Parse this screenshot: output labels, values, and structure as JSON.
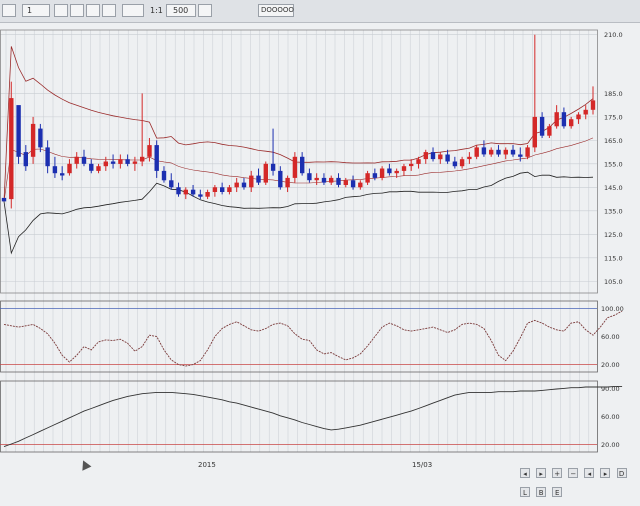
{
  "toolbar": {
    "period_value": "1",
    "mode_label": "1:1",
    "count_value": "500",
    "symbol_label": "DOOOOO"
  },
  "chart_data": {
    "type": "candlestick",
    "price_axis": {
      "ticks": [
        "210.0",
        "185.0",
        "175.0",
        "165.0",
        "155.0",
        "145.0",
        "135.0",
        "125.0",
        "115.0",
        "105.0"
      ],
      "ylim": [
        100,
        212
      ]
    },
    "osc1_axis": {
      "ticks": [
        "100.00",
        "60.00",
        "20.00"
      ]
    },
    "osc2_axis": {
      "ticks": [
        "90.00",
        "60.00",
        "20.00"
      ]
    },
    "x_labels": [
      "2015",
      "15/03"
    ],
    "candles": [
      [
        140.5,
        140.0,
        139.5,
        139.0
      ],
      [
        140.0,
        190.0,
        136.0,
        183.0
      ],
      [
        180.0,
        178.0,
        155.0,
        158.0
      ],
      [
        160.0,
        163.0,
        152.0,
        154.0
      ],
      [
        158.0,
        175.0,
        155.0,
        172.0
      ],
      [
        170.0,
        172.0,
        160.0,
        162.0
      ],
      [
        162.0,
        165.0,
        151.0,
        154.0
      ],
      [
        154.0,
        158.0,
        149.0,
        151.0
      ],
      [
        151.0,
        154.0,
        148.0,
        150.0
      ],
      [
        151.0,
        157.0,
        150.0,
        155.0
      ],
      [
        155.0,
        160.0,
        153.0,
        158.0
      ],
      [
        158.0,
        161.0,
        154.0,
        155.0
      ],
      [
        155.0,
        157.0,
        151.0,
        152.0
      ],
      [
        152.0,
        155.0,
        151.0,
        154.0
      ],
      [
        154.0,
        158.0,
        152.0,
        156.0
      ],
      [
        156.0,
        159.0,
        153.0,
        155.0
      ],
      [
        155.0,
        159.0,
        153.0,
        157.0
      ],
      [
        157.0,
        159.0,
        154.0,
        155.0
      ],
      [
        155.0,
        158.0,
        152.0,
        156.0
      ],
      [
        156.0,
        185.0,
        154.0,
        158.0
      ],
      [
        158.0,
        166.0,
        156.0,
        163.0
      ],
      [
        163.0,
        165.0,
        149.0,
        152.0
      ],
      [
        152.0,
        154.0,
        147.0,
        148.0
      ],
      [
        148.0,
        151.0,
        144.0,
        145.0
      ],
      [
        145.0,
        147.0,
        141.0,
        142.0
      ],
      [
        142.0,
        145.0,
        140.0,
        144.0
      ],
      [
        144.0,
        146.0,
        141.0,
        142.0
      ],
      [
        142.0,
        144.0,
        140.0,
        141.0
      ],
      [
        141.0,
        144.0,
        140.0,
        143.0
      ],
      [
        143.0,
        146.0,
        141.0,
        145.0
      ],
      [
        145.0,
        147.0,
        142.0,
        143.0
      ],
      [
        143.0,
        146.0,
        142.0,
        145.0
      ],
      [
        145.0,
        149.0,
        143.0,
        147.0
      ],
      [
        147.0,
        149.0,
        144.0,
        145.0
      ],
      [
        145.0,
        152.0,
        143.0,
        150.0
      ],
      [
        150.0,
        153.0,
        146.0,
        147.0
      ],
      [
        147.0,
        156.0,
        146.0,
        155.0
      ],
      [
        155.0,
        170.0,
        150.0,
        152.0
      ],
      [
        152.0,
        154.0,
        144.0,
        145.0
      ],
      [
        145.0,
        150.0,
        143.0,
        149.0
      ],
      [
        149.0,
        160.0,
        147.0,
        158.0
      ],
      [
        158.0,
        160.0,
        150.0,
        151.0
      ],
      [
        151.0,
        153.0,
        147.0,
        148.0
      ],
      [
        148.0,
        151.0,
        146.0,
        149.0
      ],
      [
        149.0,
        151.0,
        146.0,
        147.0
      ],
      [
        147.0,
        150.0,
        146.0,
        149.0
      ],
      [
        149.0,
        151.0,
        145.0,
        146.0
      ],
      [
        146.0,
        149.0,
        145.0,
        148.0
      ],
      [
        148.0,
        150.0,
        144.0,
        145.0
      ],
      [
        145.0,
        148.0,
        144.0,
        147.0
      ],
      [
        147.0,
        152.0,
        146.0,
        151.0
      ],
      [
        151.0,
        153.0,
        148.0,
        149.0
      ],
      [
        149.0,
        154.0,
        148.0,
        153.0
      ],
      [
        153.0,
        155.0,
        150.0,
        151.0
      ],
      [
        151.0,
        153.0,
        149.0,
        152.0
      ],
      [
        152.0,
        155.0,
        150.0,
        154.0
      ],
      [
        154.0,
        157.0,
        152.0,
        155.0
      ],
      [
        155.0,
        158.0,
        153.0,
        157.0
      ],
      [
        157.0,
        161.0,
        155.0,
        160.0
      ],
      [
        160.0,
        162.0,
        156.0,
        157.0
      ],
      [
        157.0,
        160.0,
        155.0,
        159.0
      ],
      [
        159.0,
        161.0,
        155.0,
        156.0
      ],
      [
        156.0,
        158.0,
        153.0,
        154.0
      ],
      [
        154.0,
        158.0,
        153.0,
        157.0
      ],
      [
        157.0,
        160.0,
        155.0,
        158.0
      ],
      [
        158.0,
        163.0,
        157.0,
        162.0
      ],
      [
        162.0,
        165.0,
        158.0,
        159.0
      ],
      [
        159.0,
        162.0,
        158.0,
        161.0
      ],
      [
        161.0,
        163.0,
        158.0,
        159.0
      ],
      [
        159.0,
        162.0,
        157.0,
        161.0
      ],
      [
        161.0,
        163.0,
        158.0,
        159.0
      ],
      [
        159.0,
        162.0,
        156.0,
        158.0
      ],
      [
        158.0,
        163.0,
        157.0,
        162.0
      ],
      [
        162.0,
        210.0,
        160.0,
        175.0
      ],
      [
        175.0,
        177.0,
        166.0,
        167.0
      ],
      [
        167.0,
        172.0,
        166.0,
        171.0
      ],
      [
        171.0,
        180.0,
        170.0,
        177.0
      ],
      [
        177.0,
        179.0,
        170.0,
        171.0
      ],
      [
        171.0,
        175.0,
        170.0,
        174.0
      ],
      [
        174.0,
        177.0,
        172.0,
        176.0
      ],
      [
        176.0,
        180.0,
        174.0,
        178.0
      ],
      [
        178.0,
        188.0,
        176.0,
        182.0
      ]
    ],
    "osc1": [
      68,
      66,
      64,
      66,
      68,
      62,
      54,
      40,
      22,
      12,
      22,
      35,
      30,
      42,
      45,
      44,
      46,
      40,
      28,
      35,
      52,
      50,
      30,
      15,
      8,
      6,
      8,
      14,
      30,
      50,
      62,
      68,
      72,
      66,
      60,
      58,
      62,
      68,
      70,
      66,
      54,
      46,
      44,
      30,
      24,
      26,
      20,
      15,
      18,
      24,
      36,
      50,
      64,
      70,
      66,
      60,
      58,
      60,
      62,
      64,
      60,
      56,
      60,
      68,
      70,
      68,
      62,
      44,
      22,
      14,
      28,
      48,
      70,
      74,
      70,
      64,
      60,
      58,
      70,
      72,
      60,
      52,
      64,
      78,
      82,
      88
    ],
    "osc2": [
      5,
      9,
      13,
      18,
      23,
      28,
      33,
      38,
      43,
      48,
      53,
      58,
      62,
      66,
      70,
      74,
      77,
      80,
      82,
      84,
      85,
      86,
      86,
      86,
      85,
      84,
      83,
      81,
      79,
      77,
      75,
      72,
      70,
      67,
      64,
      61,
      58,
      55,
      51,
      48,
      45,
      41,
      38,
      35,
      32,
      30,
      31,
      33,
      35,
      37,
      40,
      43,
      46,
      49,
      52,
      55,
      58,
      62,
      66,
      70,
      74,
      78,
      82,
      84,
      86,
      86,
      86,
      86,
      87,
      87,
      87,
      88,
      88,
      88,
      89,
      90,
      91,
      92,
      93,
      93,
      94,
      94,
      94,
      94,
      95,
      95
    ]
  },
  "bottom_bar": {
    "buttons": [
      "◂",
      "▸",
      "+",
      "−",
      "◂",
      "▸",
      "D",
      "L",
      "B",
      "E"
    ]
  },
  "colors": {
    "up": "#d42828",
    "down": "#1c2fb0",
    "band": "#9a2b2b",
    "ma": "#222222",
    "background": "#eef0f2",
    "grid": "#c8ccd2"
  }
}
